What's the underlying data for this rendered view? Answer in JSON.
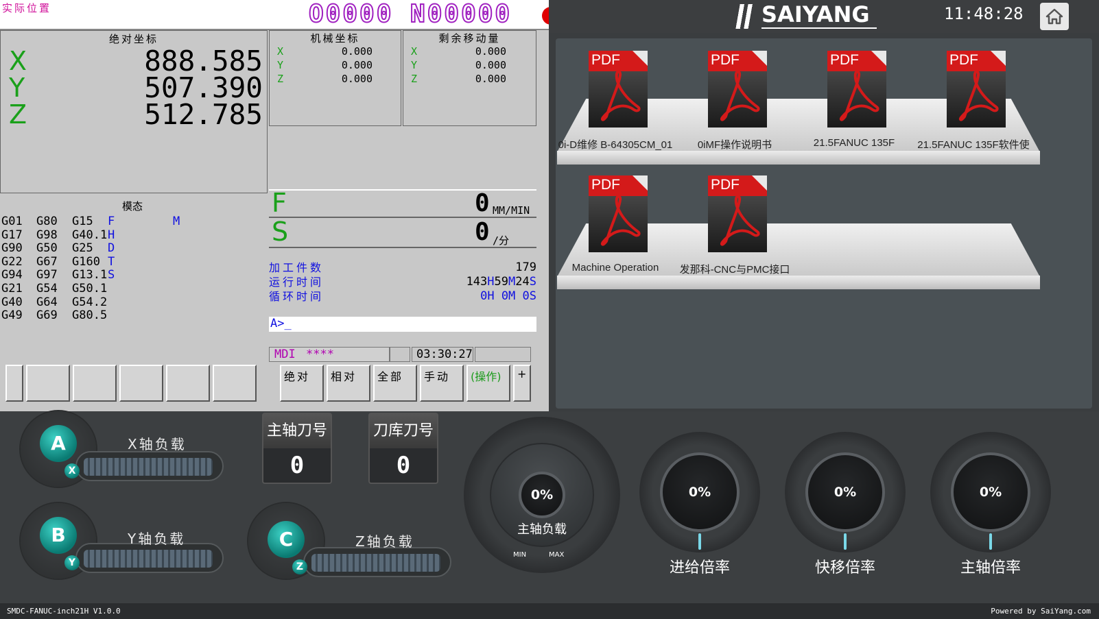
{
  "cnc": {
    "screen_title": "实际位置",
    "program_no": "O0000 N00000",
    "absolute": {
      "title": "绝对坐标",
      "axes": [
        {
          "axis": "X",
          "value": "888.585"
        },
        {
          "axis": "Y",
          "value": "507.390"
        },
        {
          "axis": "Z",
          "value": "512.785"
        }
      ]
    },
    "machine": {
      "title": "机械坐标",
      "axes": [
        {
          "axis": "X",
          "value": "0.000"
        },
        {
          "axis": "Y",
          "value": "0.000"
        },
        {
          "axis": "Z",
          "value": "0.000"
        }
      ]
    },
    "remaining": {
      "title": "剩余移动量",
      "axes": [
        {
          "axis": "X",
          "value": "0.000"
        },
        {
          "axis": "Y",
          "value": "0.000"
        },
        {
          "axis": "Z",
          "value": "0.000"
        }
      ]
    },
    "modal": {
      "title": "模态",
      "col1": [
        "G01",
        "G17",
        "G90",
        "G22",
        "G94",
        "G21",
        "G40",
        "G49"
      ],
      "col2": [
        "G80",
        "G98",
        "G50",
        "G67",
        "G97",
        "G54",
        "G64",
        "G69"
      ],
      "col3": [
        "G15",
        "G40.1",
        "G25",
        "G160",
        "G13.1",
        "G50.1",
        "G54.2",
        "G80.5"
      ],
      "col4": [
        "F",
        "H",
        "D",
        "T",
        "S"
      ],
      "m_label": "M"
    },
    "feed": {
      "letter": "F",
      "value": "0",
      "unit": "MM/MIN"
    },
    "spindle": {
      "letter": "S",
      "value": "0",
      "unit": "/分"
    },
    "counters": {
      "parts_label": "加工件数",
      "parts_value": "179",
      "run_label": "运行时间",
      "run_h": "143",
      "run_m": "59",
      "run_s": "24",
      "cycle_label": "循环时间",
      "cycle_value": "0H 0M 0S"
    },
    "prompt": "A>_",
    "status": {
      "mode": "MDI",
      "stars": "****",
      "time": "03:30:27"
    },
    "softkeys": [
      "绝对",
      "相对",
      "全部",
      "手动",
      "(操作)",
      "+"
    ]
  },
  "header": {
    "brand": "SAIYANG",
    "clock": "11:48:28",
    "home_icon": "home-icon"
  },
  "library": {
    "row1": [
      "0i-D维修 B-64305CM_01",
      "0iMF操作说明书",
      "21.5FANUC 135F",
      "21.5FANUC 135F软件使"
    ],
    "row2": [
      "Machine Operation",
      "发那科-CNC与PMC接口"
    ],
    "badge": "PDF"
  },
  "dashboard": {
    "loads": [
      {
        "ball": "A",
        "axis": "X",
        "label": "X轴负载"
      },
      {
        "ball": "B",
        "axis": "Y",
        "label": "Y轴负载"
      },
      {
        "ball": "C",
        "axis": "Z",
        "label": "Z轴负载"
      }
    ],
    "spindle_tool": {
      "title": "主轴刀号",
      "value": "0"
    },
    "magazine_tool": {
      "title": "刀库刀号",
      "value": "0"
    },
    "spindle_load": {
      "value": "0%",
      "label": "主轴负载",
      "min": "MIN",
      "max": "MAX"
    },
    "dials": [
      {
        "value": "0%",
        "label": "进给倍率"
      },
      {
        "value": "0%",
        "label": "快移倍率"
      },
      {
        "value": "0%",
        "label": "主轴倍率"
      }
    ]
  },
  "footer": {
    "version": "SMDC-FANUC-inch21H V1.0.0",
    "powered": "Powered by SaiYang.com"
  },
  "colors": {
    "accent": "#1aa01a",
    "program": "#a020c0",
    "teal": "#1aa89c",
    "record": "#e00000"
  }
}
